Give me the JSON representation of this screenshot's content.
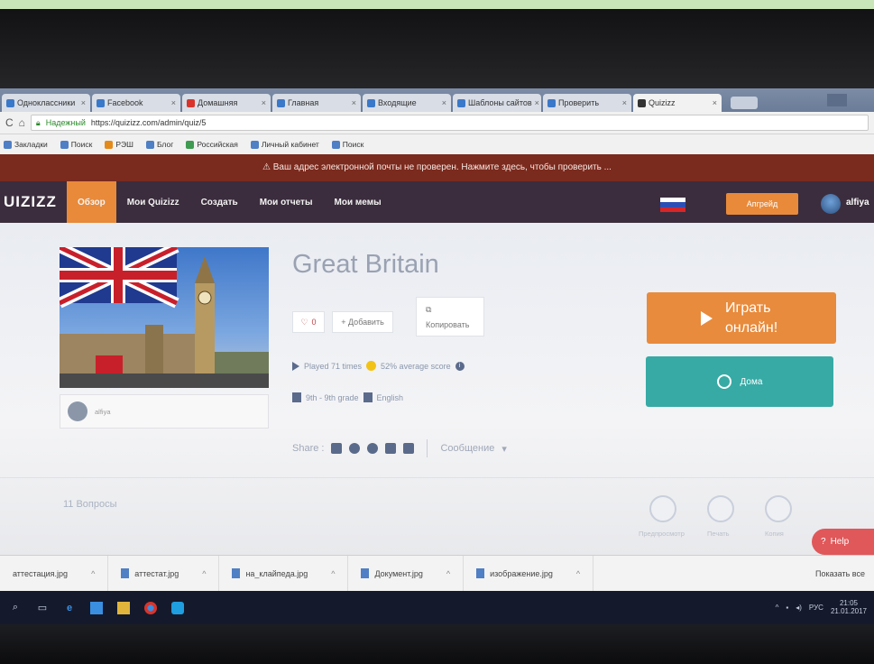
{
  "browser": {
    "tabs": [
      {
        "label": "Одноклассники",
        "active": false
      },
      {
        "label": "Facebook",
        "active": false
      },
      {
        "label": "Домашняя",
        "active": false
      },
      {
        "label": "Главная",
        "active": false
      },
      {
        "label": "Входящие",
        "active": false
      },
      {
        "label": "Шаблоны сайтов",
        "active": false
      },
      {
        "label": "Проверить",
        "active": false
      },
      {
        "label": "Quizizz",
        "active": true
      }
    ],
    "url": "https://quizizz.com/admin/quiz/5",
    "secure_label": "Надежный",
    "bookmarks": [
      "Закладки",
      "Поиск",
      "РЭШ",
      "Блог",
      "Российская",
      "Личный кабинет",
      "Поиск"
    ]
  },
  "notice": "⚠ Ваш адрес электронной почты не проверен. Нажмите здесь, чтобы проверить ...",
  "header": {
    "logo": "UIZIZZ",
    "nav": [
      "Обзор",
      "Мои Quizizz",
      "Создать",
      "Мои отчеты",
      "Мои мемы"
    ],
    "active_nav": "Обзор",
    "upgrade_label": "Апгрейд",
    "username": "alfiya"
  },
  "quiz": {
    "title": "Great Britain",
    "like_count": "0",
    "add_label": "+ Добавить",
    "copy_label": "Копировать",
    "played": "Played 71 times",
    "accuracy": "52% average score",
    "grade": "9th - 9th grade",
    "language": "English",
    "share_label": "Share :",
    "report_label": "Сообщение",
    "questions_count": "11 Вопросы",
    "creator": "alfiya"
  },
  "actions": {
    "play_label": "Играть онлайн!",
    "home_label": "Дома",
    "preview_label": "Предпросмотр",
    "print_label": "Печать",
    "edit_label": "Копия",
    "help_label": "Help"
  },
  "downloads": [
    "аттестация.jpg",
    "аттестат.jpg",
    "на_клайпедa.jpg",
    "Документ.jpg",
    "изображение.jpg"
  ],
  "downloads_show_all": "Показать все",
  "tray": {
    "lang": "РУС",
    "time": "21:05",
    "date": "21.01.2017"
  },
  "colors": {
    "brand_header": "#3b2d3d",
    "accent_orange": "#e88a3a",
    "teal": "#37aaa5",
    "notice_red": "#7b2a1e"
  }
}
